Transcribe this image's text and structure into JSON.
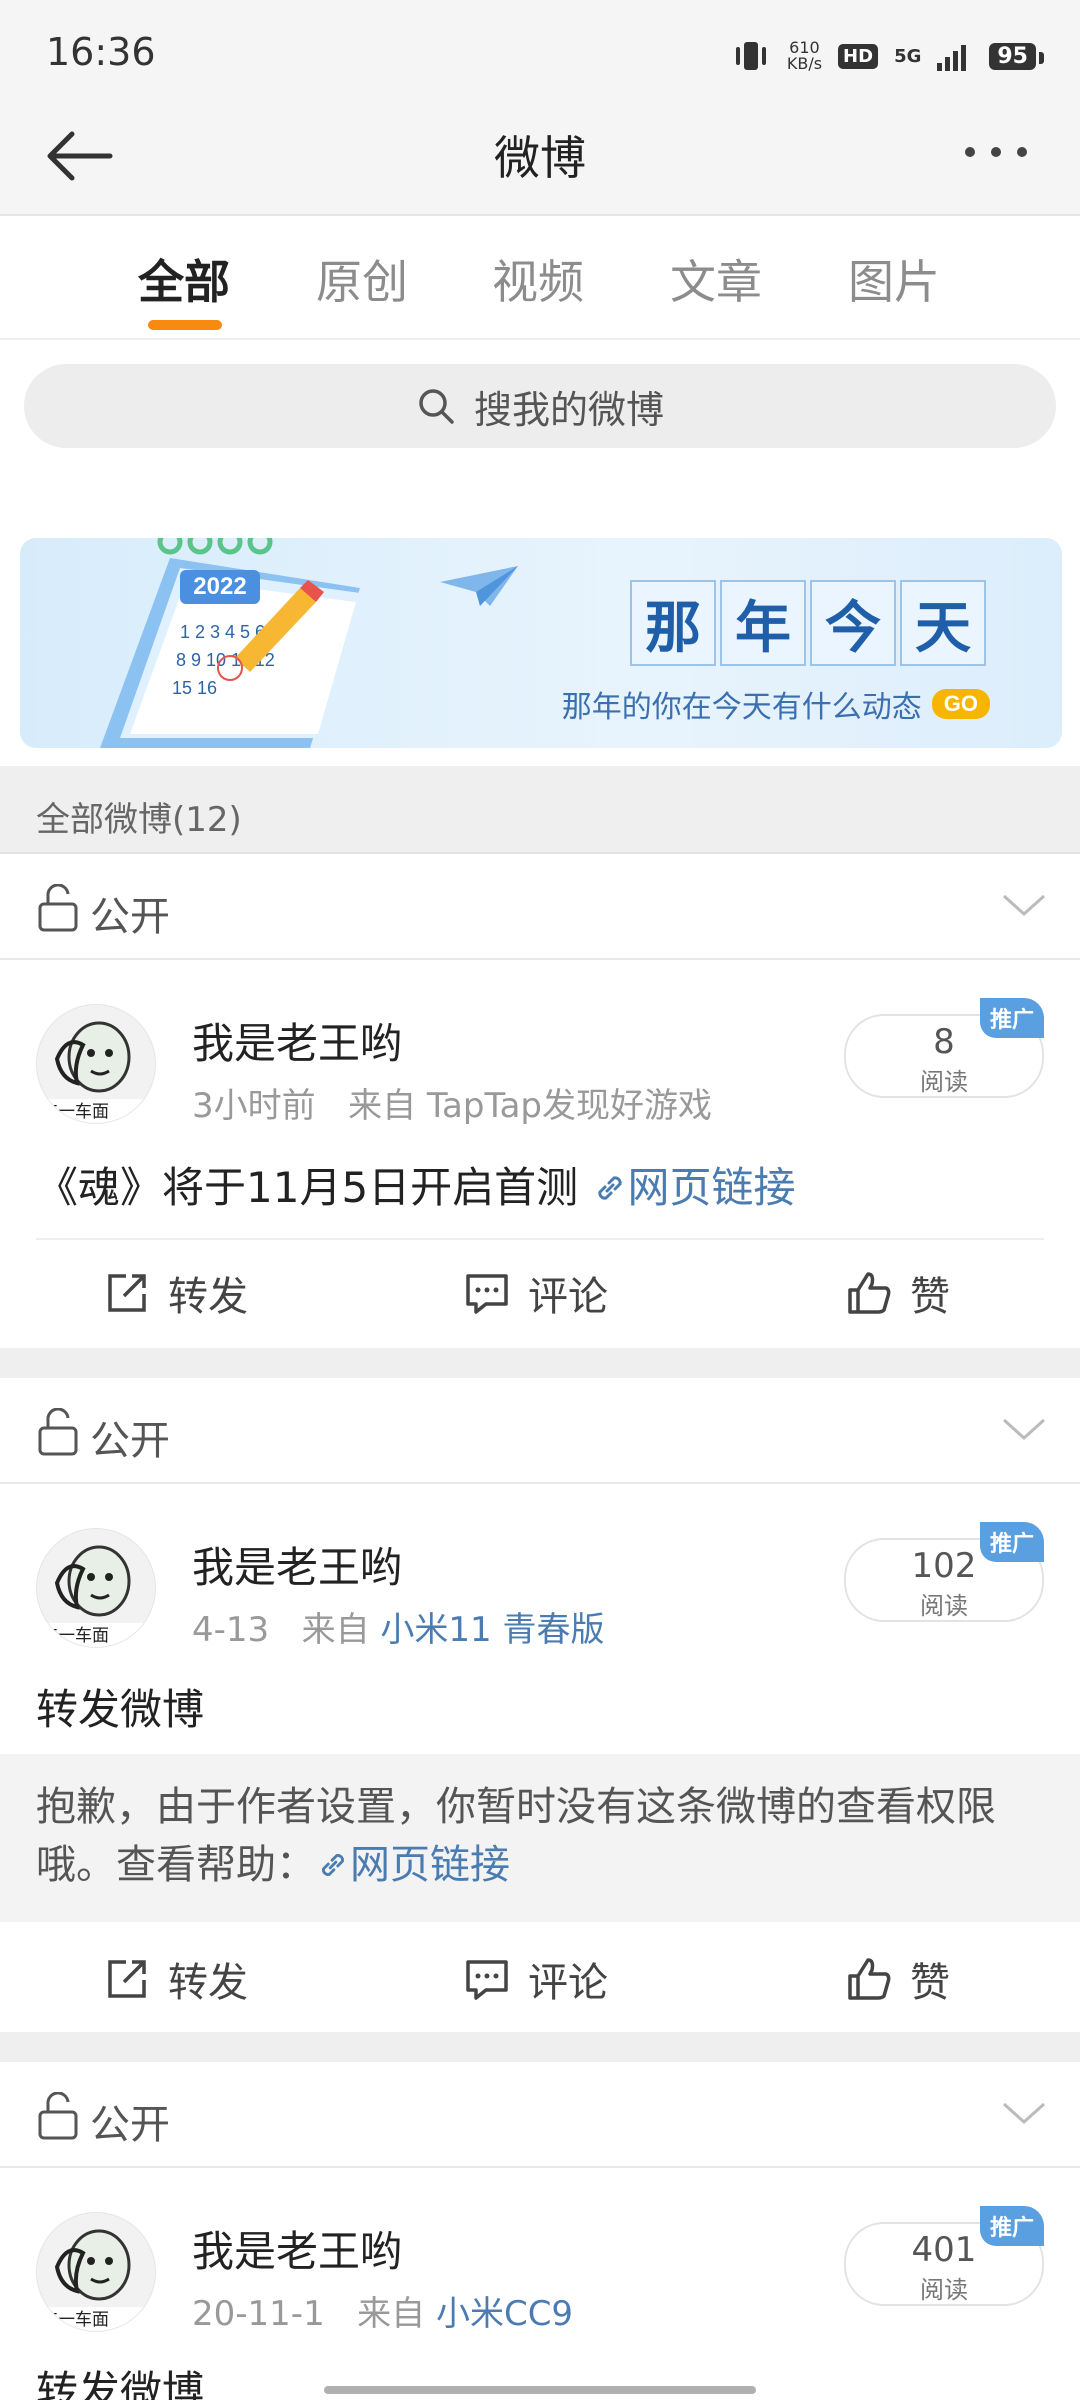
{
  "status": {
    "time": "16:36",
    "net_speed_value": "610",
    "net_speed_unit": "KB/s",
    "hd": "HD",
    "network": "5G",
    "battery": "95"
  },
  "header": {
    "title": "微博"
  },
  "tabs": [
    {
      "label": "全部",
      "active": true
    },
    {
      "label": "原创",
      "active": false
    },
    {
      "label": "视频",
      "active": false
    },
    {
      "label": "文章",
      "active": false
    },
    {
      "label": "图片",
      "active": false
    }
  ],
  "search": {
    "placeholder": "搜我的微博"
  },
  "banner": {
    "calendar_year": "2022",
    "title_chars": [
      "那",
      "年",
      "今",
      "天"
    ],
    "subtitle": "那年的你在今天有什么动态",
    "go": "GO"
  },
  "summary": {
    "label": "全部微博(12)"
  },
  "actions": {
    "repost": "转发",
    "comment": "评论",
    "like": "赞"
  },
  "posts": [
    {
      "visibility": "公开",
      "username": "我是老王哟",
      "time": "3小时前",
      "source_prefix": "来自",
      "source": "TapTap发现好游戏",
      "reads": "8",
      "reads_label": "阅读",
      "badge": "推广",
      "text": "《魂》将于11月5日开启首测",
      "link_text": "网页链接"
    },
    {
      "visibility": "公开",
      "username": "我是老王哟",
      "time": "4-13",
      "source_prefix": "来自",
      "source": "小米11 青春版",
      "reads": "102",
      "reads_label": "阅读",
      "badge": "推广",
      "text": "转发微博",
      "forward_text": "抱歉，由于作者设置，你暂时没有这条微博的查看权限哦。查看帮助：",
      "forward_link": "网页链接"
    },
    {
      "visibility": "公开",
      "username": "我是老王哟",
      "time": "20-11-1",
      "source_prefix": "来自",
      "source": "小米CC9",
      "reads": "401",
      "reads_label": "阅读",
      "badge": "推广",
      "text": "转发微博"
    }
  ]
}
